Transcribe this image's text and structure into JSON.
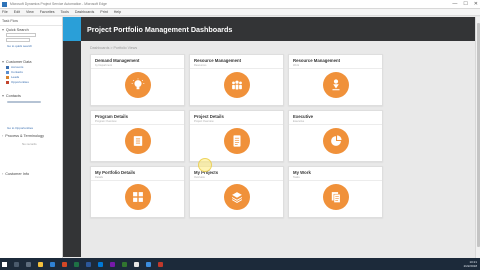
{
  "window": {
    "title": "Microsoft Dynamics Project Service Automation - Microsoft Edge",
    "controls": [
      "—",
      "☐",
      "✕"
    ]
  },
  "menu": [
    "File",
    "Edit",
    "View",
    "Favorites",
    "Tools",
    "Dashboards",
    "Print",
    "Help"
  ],
  "sidebar": {
    "header": "Task Flow",
    "sections": {
      "quick_search": "Quick Search",
      "customer_data": "Customer Data",
      "contacts": "Contacts",
      "process": "Process & Terminology",
      "customer_info": "Customer Info"
    },
    "links": {
      "quick_link": "Go to quick search",
      "account": "Accounts",
      "contact": "Contacts",
      "lead": "Leads",
      "opportunity": "Opportunities",
      "opp_link": "Go to Opportunities",
      "no_records": "No records"
    }
  },
  "page": {
    "title": "Project Portfolio Management Dashboards",
    "breadcrumb": "Dashboards > Portfolio Views"
  },
  "cards": [
    {
      "title": "Demand Management",
      "subtitle": "by Department",
      "icon": "lightbulb-icon"
    },
    {
      "title": "Resource Management",
      "subtitle": "Resources",
      "icon": "team-icon"
    },
    {
      "title": "Resource Management",
      "subtitle": "Work",
      "icon": "resource-download-icon"
    },
    {
      "title": "Program Details",
      "subtitle": "Program Overview",
      "icon": "checklist-icon"
    },
    {
      "title": "Project Details",
      "subtitle": "Project Overview",
      "icon": "document-list-icon"
    },
    {
      "title": "Executive",
      "subtitle": "Executive",
      "icon": "pie-chart-icon"
    },
    {
      "title": "My Portfolio Details",
      "subtitle": "Details",
      "icon": "portfolio-docs-icon"
    },
    {
      "title": "My Projects",
      "subtitle": "Overview",
      "icon": "layers-icon"
    },
    {
      "title": "My Work",
      "subtitle": "Tasks",
      "icon": "my-work-icon"
    }
  ],
  "taskbar": {
    "time": "10:21",
    "date": "2/22/2018"
  },
  "colors": {
    "accent_orange": "#f0913a",
    "header_dark": "#333436",
    "header_cap_blue": "#2a9fd8"
  }
}
